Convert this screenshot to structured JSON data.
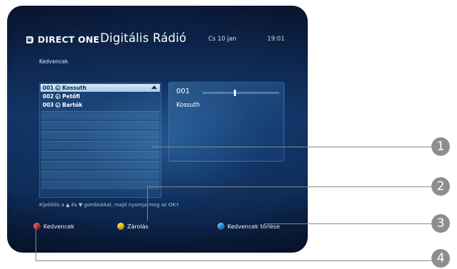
{
  "header": {
    "brand": "DIRECT ONE",
    "title": "Digitális Rádió",
    "date": "Cs 10 jan",
    "time": "19:01"
  },
  "section_label": "Kedvencek",
  "list": {
    "rows": [
      {
        "num": "001",
        "name": "Kossuth",
        "selected": true
      },
      {
        "num": "002",
        "name": "Petőfi",
        "selected": false
      },
      {
        "num": "003",
        "name": "Bartók",
        "selected": false
      }
    ]
  },
  "info_panel": {
    "number": "001",
    "name": "Kossuth"
  },
  "hint": "Kijelölés a ▲ és ▼ gombokkal, majd nyomja meg az OK-t",
  "footer": {
    "red": {
      "label": "Kedvencek",
      "color": "#d3333a"
    },
    "yellow": {
      "label": "Zárolás",
      "color": "#e8c21c"
    },
    "blue": {
      "label": "Kedvencek törlése",
      "color": "#2f8fe0"
    }
  },
  "callouts": [
    "1",
    "2",
    "3",
    "4"
  ]
}
